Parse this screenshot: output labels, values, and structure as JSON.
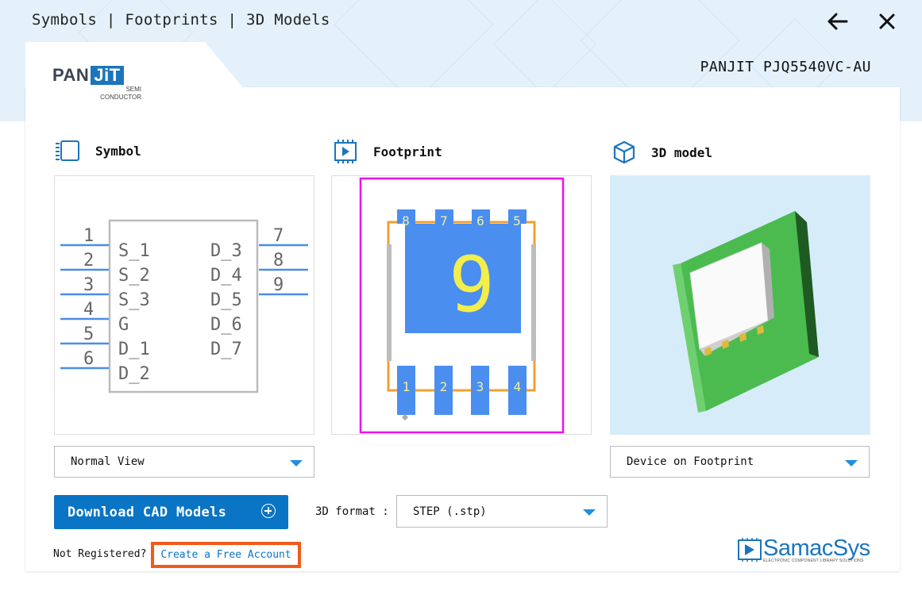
{
  "header": {
    "title": "Symbols | Footprints | 3D Models",
    "back_icon": "arrow-left-icon",
    "close_icon": "close-icon"
  },
  "brand": {
    "logo_main_a": "PAN",
    "logo_main_b": "JiT",
    "logo_sub_1": "SEMI",
    "logo_sub_2": "CONDUCTOR",
    "part_name": "PANJIT PJQ5540VC-AU"
  },
  "sections": {
    "symbol": {
      "label": "Symbol",
      "icon": "chip-icon"
    },
    "footprint": {
      "label": "Footprint",
      "icon": "footprint-icon"
    },
    "model": {
      "label": "3D model",
      "icon": "cube-icon"
    }
  },
  "symbol": {
    "left_pins": [
      "1",
      "2",
      "3",
      "4",
      "5",
      "6"
    ],
    "right_pins": [
      "7",
      "8",
      "9"
    ],
    "left_labels": [
      "S_1",
      "S_2",
      "S_3",
      "G",
      "D_1",
      "D_2"
    ],
    "right_labels": [
      "D_3",
      "D_4",
      "D_5",
      "D_6",
      "D_7"
    ]
  },
  "footprint": {
    "top_pads": [
      "8",
      "7",
      "6",
      "5"
    ],
    "bottom_pads": [
      "1",
      "2",
      "3",
      "4"
    ],
    "center_pad": "9"
  },
  "controls": {
    "symbol_view": "Normal View",
    "model_view": "Device on Footprint",
    "download_label": "Download CAD Models",
    "format_label": "3D format :",
    "format_value": "STEP (.stp)",
    "not_registered": "Not Registered?",
    "create_account": "Create a Free Account"
  },
  "samacsys": {
    "name": "SamacSys",
    "tagline": "ELECTRONIC COMPONENT LIBRARY SOLUTIONS"
  },
  "colors": {
    "accent": "#0a74c5",
    "highlight": "#f25a1b",
    "pad_blue": "#4a8ef0",
    "outline_orange": "#f0a030",
    "footprint_border": "#ee11ee",
    "model_green": "#48b54d"
  }
}
